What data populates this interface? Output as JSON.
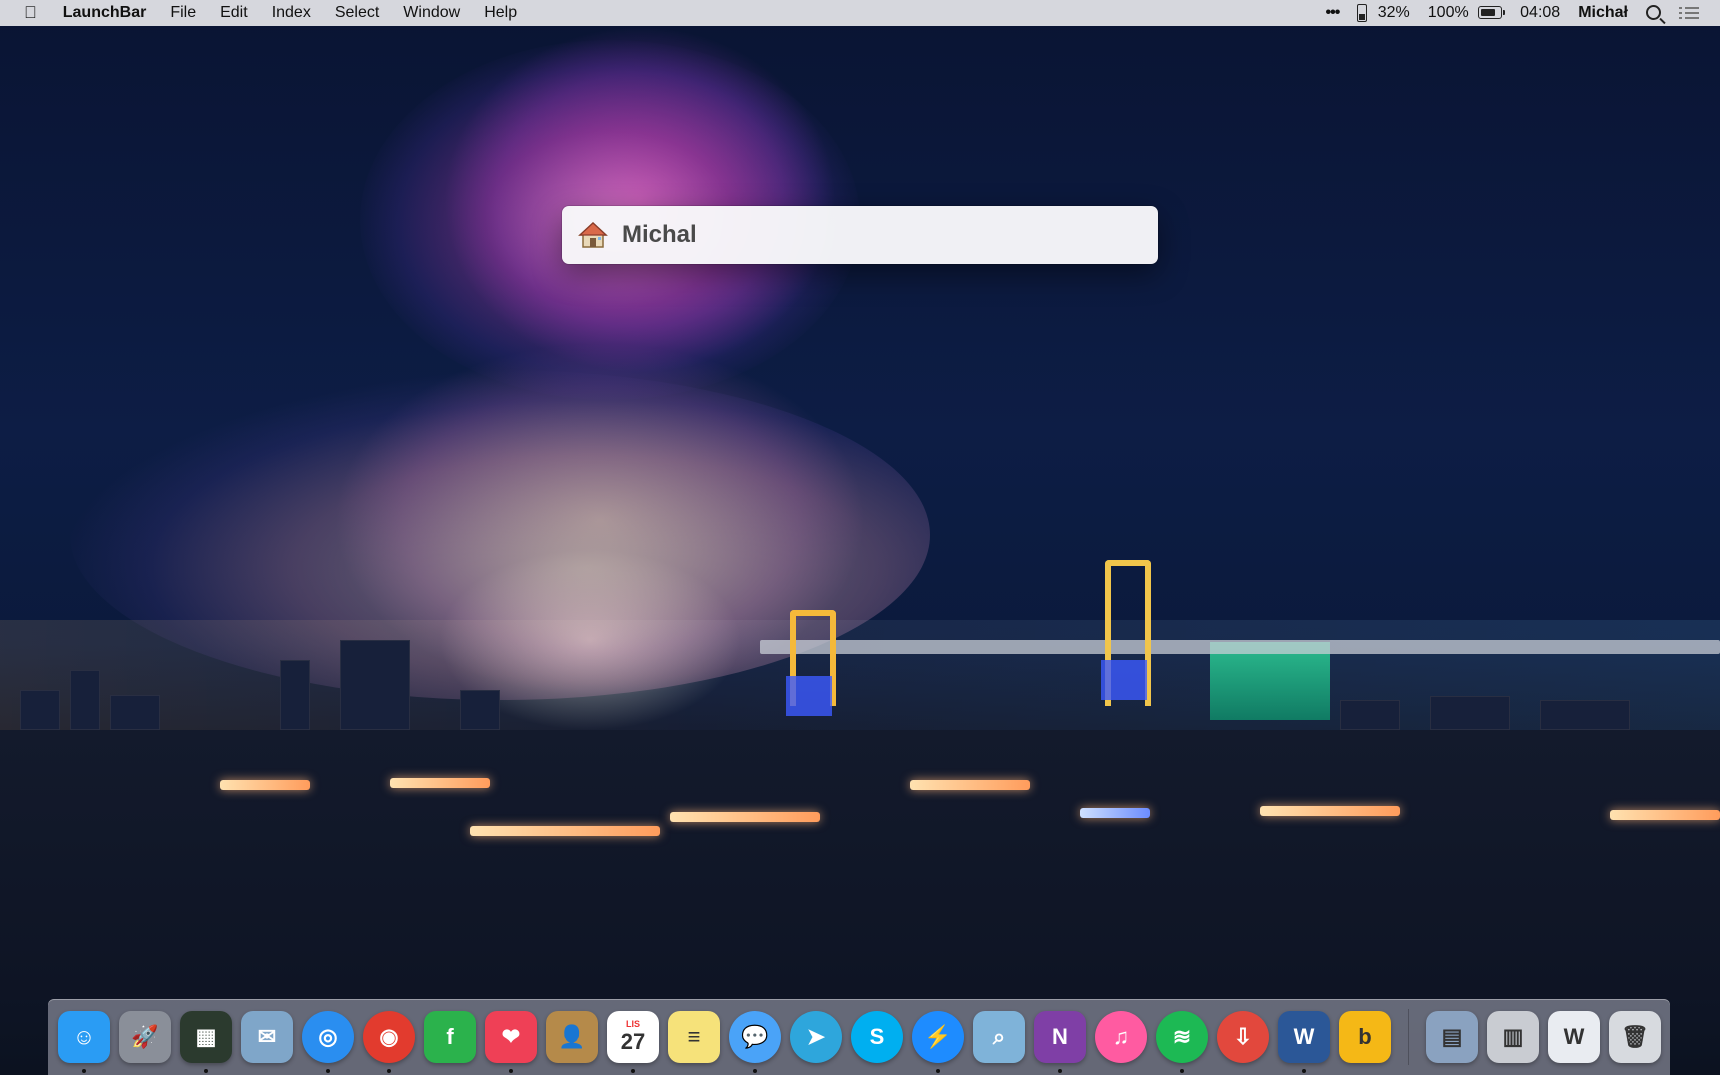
{
  "menubar": {
    "apple_icon": "apple-icon",
    "app_name": "LaunchBar",
    "menus": [
      "File",
      "Edit",
      "Index",
      "Select",
      "Window",
      "Help"
    ],
    "more_icon": "•••",
    "phone_battery": "32%",
    "battery": "100%",
    "time": "04:08",
    "user": "Michał"
  },
  "launchbar": {
    "icon": "home-icon",
    "text": "Michal"
  },
  "dock": {
    "apps": [
      {
        "name": "Finder",
        "icon": "finder-icon",
        "glyph": "☺",
        "color": "#2a9cf4"
      },
      {
        "name": "Launchpad",
        "icon": "launchpad-icon",
        "glyph": "🚀",
        "color": "#8a8f99"
      },
      {
        "name": "Mission Control",
        "icon": "mission-control-icon",
        "glyph": "▦",
        "color": "#2b3a2e"
      },
      {
        "name": "Mail",
        "icon": "mail-icon",
        "glyph": "✉",
        "color": "#7fa6c9"
      },
      {
        "name": "Safari",
        "icon": "safari-icon",
        "glyph": "◎",
        "color": "#2a8ef0"
      },
      {
        "name": "Chrome",
        "icon": "chrome-icon",
        "glyph": "◉",
        "color": "#e23b2e"
      },
      {
        "name": "Feedly",
        "icon": "feedly-icon",
        "glyph": "f",
        "color": "#2bb24c"
      },
      {
        "name": "Pocket",
        "icon": "pocket-icon",
        "glyph": "❤",
        "color": "#ef4056"
      },
      {
        "name": "Contacts",
        "icon": "contacts-icon",
        "glyph": "👤",
        "color": "#b58a4a"
      },
      {
        "name": "Calendar",
        "icon": "calendar-icon",
        "glyph": "27",
        "color": "#ffffff"
      },
      {
        "name": "Notes",
        "icon": "notes-icon",
        "glyph": "≡",
        "color": "#f6e27a"
      },
      {
        "name": "Messages",
        "icon": "messages-icon",
        "glyph": "💬",
        "color": "#4aa3f8"
      },
      {
        "name": "Telegram",
        "icon": "telegram-icon",
        "glyph": "➤",
        "color": "#2ea6dc"
      },
      {
        "name": "Skype",
        "icon": "skype-icon",
        "glyph": "S",
        "color": "#00aff0"
      },
      {
        "name": "Messenger",
        "icon": "messenger-icon",
        "glyph": "⚡",
        "color": "#1e8cff"
      },
      {
        "name": "Preview",
        "icon": "preview-icon",
        "glyph": "⌕",
        "color": "#7fb3d9"
      },
      {
        "name": "OneNote",
        "icon": "onenote-icon",
        "glyph": "N",
        "color": "#7f3fa6"
      },
      {
        "name": "iTunes",
        "icon": "itunes-icon",
        "glyph": "♫",
        "color": "#ff5ba1"
      },
      {
        "name": "Spotify",
        "icon": "spotify-icon",
        "glyph": "≋",
        "color": "#1db954"
      },
      {
        "name": "Transmit",
        "icon": "transmit-icon",
        "glyph": "⇩",
        "color": "#e2483d"
      },
      {
        "name": "Word",
        "icon": "word-icon",
        "glyph": "W",
        "color": "#2b5797"
      },
      {
        "name": "Bing",
        "icon": "bing-icon",
        "glyph": "b",
        "color": "#f5b816"
      }
    ],
    "stacks": [
      {
        "name": "Photos folder",
        "icon": "photos-folder-icon",
        "glyph": "▤",
        "color": "#8aa2c0"
      },
      {
        "name": "Document stack",
        "icon": "document-stack-icon",
        "glyph": "▥",
        "color": "#c9ccd2"
      },
      {
        "name": "Word document",
        "icon": "word-document-icon",
        "glyph": "W",
        "color": "#e9ecf1"
      },
      {
        "name": "Trash",
        "icon": "trash-icon",
        "glyph": "🗑",
        "color": "#d7dadf"
      }
    ],
    "calendar_month": "LIS"
  }
}
